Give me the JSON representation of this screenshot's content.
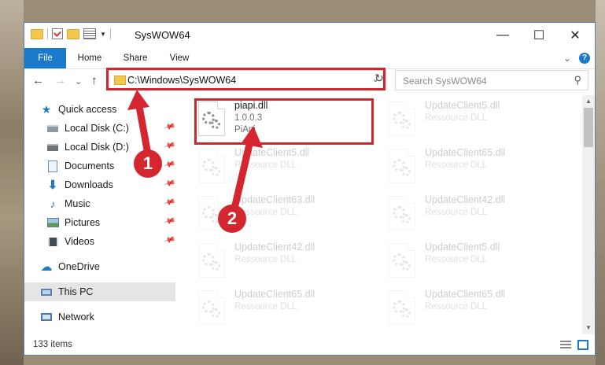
{
  "window": {
    "title": "SysWOW64",
    "controls": {
      "minimize": "—",
      "maximize": "☐",
      "close": "✕"
    }
  },
  "ribbon": {
    "tabs": [
      "File",
      "Home",
      "Share",
      "View"
    ],
    "expand_icon": "⌄",
    "help_icon": "?"
  },
  "navbar": {
    "back": "←",
    "forward": "→",
    "recent": "⌄",
    "up": "↑",
    "address": "C:\\Windows\\SysWOW64",
    "refresh": "↻",
    "search_placeholder": "Search SysWOW64"
  },
  "nav_pane": {
    "items": [
      {
        "label": "Quick access",
        "icon": "star-icon",
        "pinned": false
      },
      {
        "label": "Local Disk (C:)",
        "icon": "drive-icon",
        "pinned": true
      },
      {
        "label": "Local Disk (D:)",
        "icon": "drive-icon",
        "pinned": true
      },
      {
        "label": "Documents",
        "icon": "documents-icon",
        "pinned": true
      },
      {
        "label": "Downloads",
        "icon": "download-icon",
        "pinned": true
      },
      {
        "label": "Music",
        "icon": "music-icon",
        "pinned": true
      },
      {
        "label": "Pictures",
        "icon": "pictures-icon",
        "pinned": true
      },
      {
        "label": "Videos",
        "icon": "videos-icon",
        "pinned": true
      },
      {
        "label": "OneDrive",
        "icon": "cloud-icon",
        "pinned": false
      },
      {
        "label": "This PC",
        "icon": "computer-icon",
        "pinned": false,
        "selected": true
      },
      {
        "label": "Network",
        "icon": "network-icon",
        "pinned": false
      }
    ]
  },
  "files": {
    "highlighted": {
      "name": "piapi.dll",
      "version": "1.0.0.3",
      "description": "PiApi"
    },
    "background": [
      {
        "name": "UpdateClient5.dll",
        "type": "Ressource DLL"
      },
      {
        "name": "UpdateClient5.dll",
        "type": "Ressource DLL"
      },
      {
        "name": "UpdateClient65.dll",
        "type": "Ressource DLL"
      },
      {
        "name": "UpdateClient63.dll",
        "type": "Ressource DLL"
      },
      {
        "name": "UpdateClient42.dll",
        "type": "Ressource DLL"
      },
      {
        "name": "UpdateClient42.dll",
        "type": "Ressource DLL"
      },
      {
        "name": "UpdateClient5.dll",
        "type": "Ressource DLL"
      },
      {
        "name": "UpdateClient65.dll",
        "type": "Ressource DLL"
      },
      {
        "name": "UpdateClient65.dll",
        "type": "Ressource DLL"
      }
    ]
  },
  "status": {
    "item_count": "133 items"
  },
  "annotations": {
    "badge1": "1",
    "badge2": "2",
    "color": "#d4262e"
  }
}
